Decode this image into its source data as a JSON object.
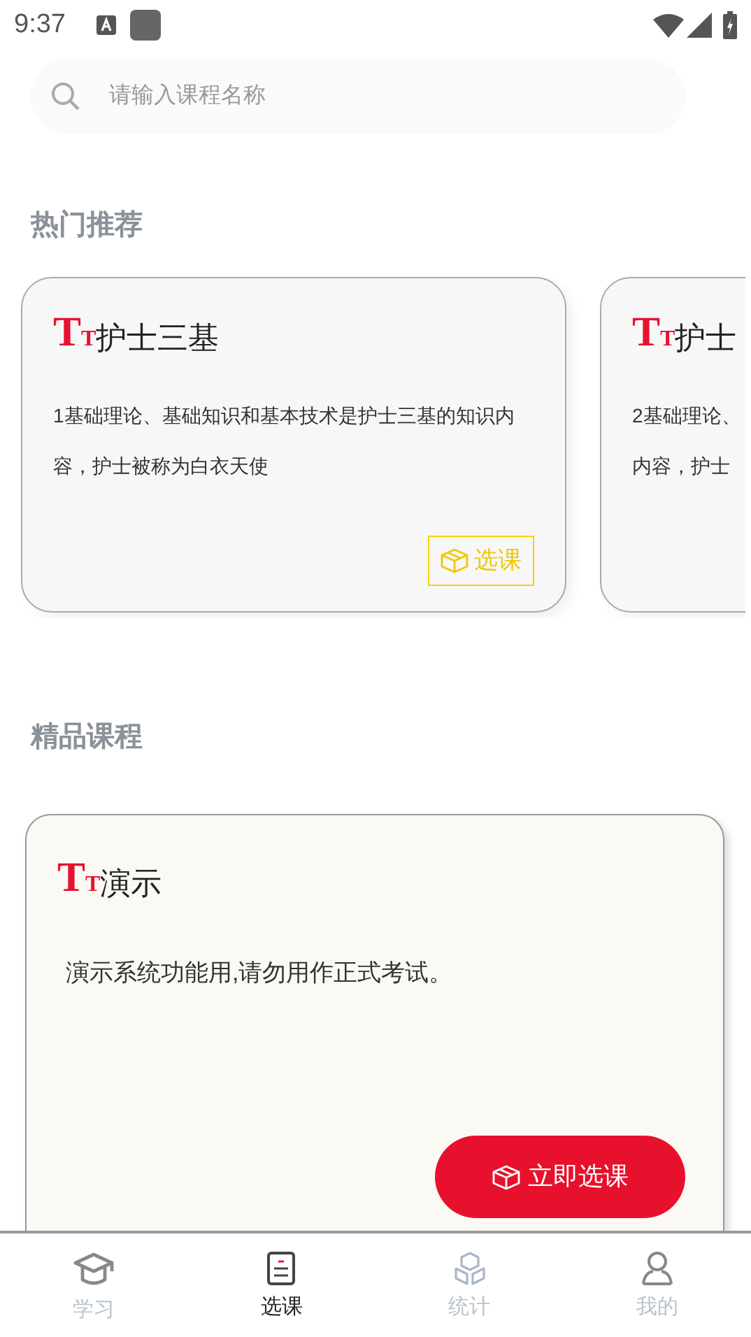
{
  "status_bar": {
    "time": "9:37"
  },
  "search": {
    "placeholder": "请输入课程名称"
  },
  "hot": {
    "title": "热门推荐",
    "cards": [
      {
        "logo": "TT",
        "title": "护士三基",
        "description": "1基础理论、基础知识和基本技术是护士三基的知识内容，护士被称为白衣天使",
        "button": "选课"
      },
      {
        "logo": "TT",
        "title": "护士",
        "description_lines": [
          "2基础理论、",
          "内容，护士"
        ]
      }
    ]
  },
  "featured": {
    "title": "精品课程",
    "card": {
      "logo": "TT",
      "title": "演示",
      "description": "演示系统功能用,请勿用作正式考试。",
      "button": "立即选课"
    }
  },
  "tabs": [
    {
      "label": "学习",
      "selected": false
    },
    {
      "label": "选课",
      "selected": true
    },
    {
      "label": "统计",
      "selected": false
    },
    {
      "label": "我的",
      "selected": false
    }
  ]
}
